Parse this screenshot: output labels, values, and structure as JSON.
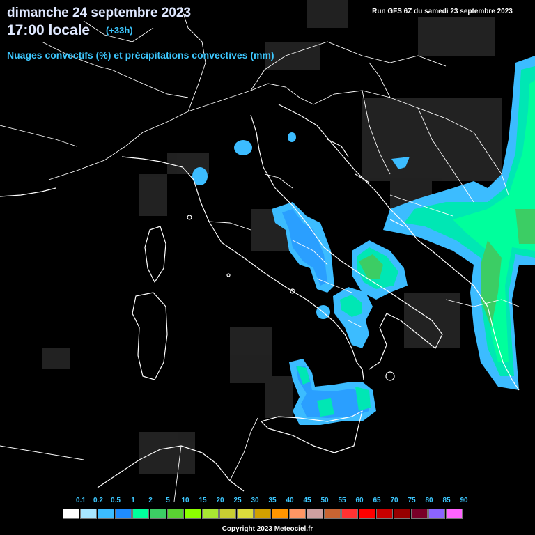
{
  "header": {
    "date": "dimanche 24 septembre 2023",
    "time": "17:00 locale",
    "offset": "(+33h)",
    "parameter": "Nuages convectifs (%) et précipitations convectives (mm)",
    "run": "Run GFS 6Z du samedi 23 septembre 2023"
  },
  "legend": {
    "labels": [
      "0.1",
      "0.2",
      "0.5",
      "1",
      "2",
      "5",
      "10",
      "15",
      "20",
      "25",
      "30",
      "35",
      "40",
      "45",
      "50",
      "55",
      "60",
      "65",
      "70",
      "75",
      "80",
      "85",
      "90"
    ],
    "colors": [
      "#ffffff",
      "#a8e6ff",
      "#3cbcff",
      "#1e8cff",
      "#00ff9c",
      "#3ccd64",
      "#5ad232",
      "#8cff00",
      "#a8e632",
      "#c8cd32",
      "#dcdc3c",
      "#d2a000",
      "#ff9600",
      "#ff9664",
      "#cda0a0",
      "#c86432",
      "#ff3232",
      "#ff0000",
      "#c80000",
      "#960000",
      "#780028",
      "#8c64ff",
      "#ff64ff"
    ]
  },
  "copyright": "Copyright 2023 Meteociel.fr"
}
